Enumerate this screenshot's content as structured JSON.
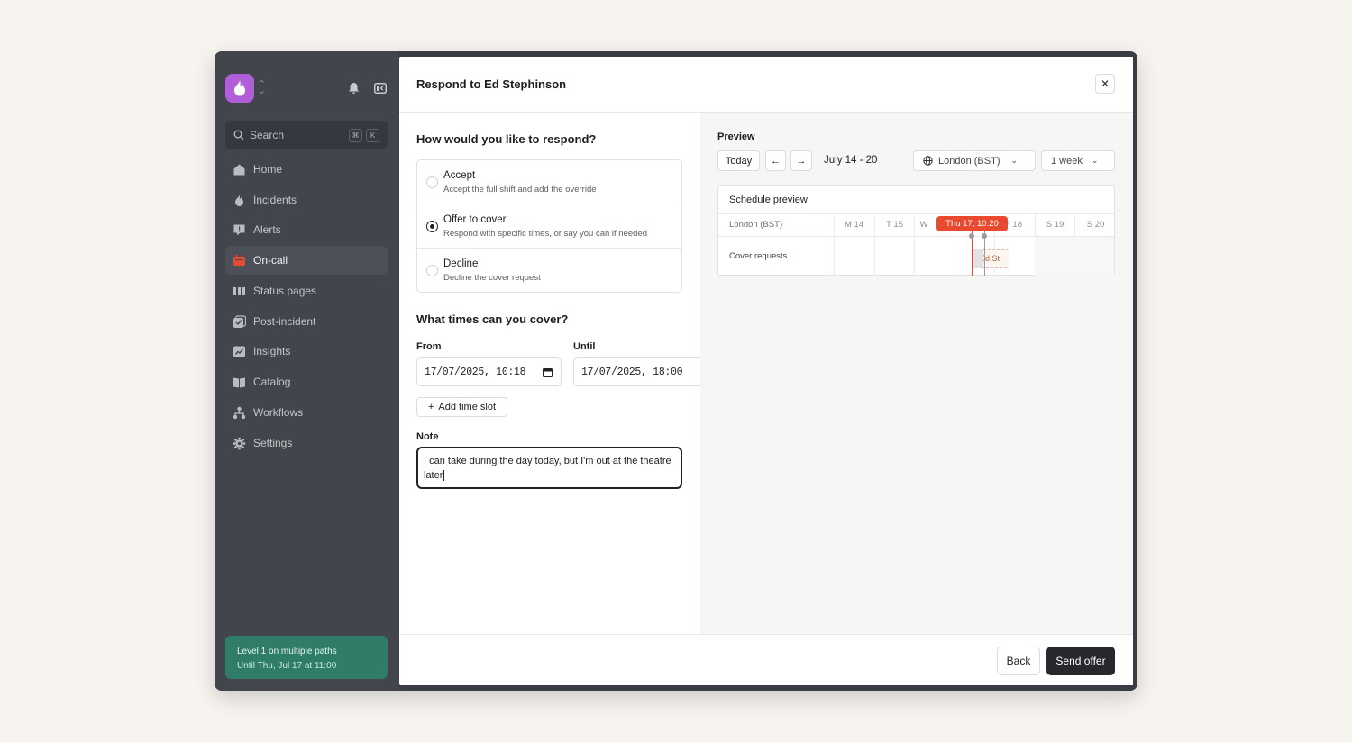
{
  "sidebar": {
    "search_placeholder": "Search",
    "shortcut_keys": [
      "⌘",
      "K"
    ],
    "items": [
      {
        "label": "Home",
        "icon": "home-icon"
      },
      {
        "label": "Incidents",
        "icon": "flame-icon"
      },
      {
        "label": "Alerts",
        "icon": "alert-icon"
      },
      {
        "label": "On-call",
        "icon": "on-call-icon",
        "active": true
      },
      {
        "label": "Status pages",
        "icon": "status-pages-icon"
      },
      {
        "label": "Post-incident",
        "icon": "post-incident-icon"
      },
      {
        "label": "Insights",
        "icon": "insights-icon"
      },
      {
        "label": "Catalog",
        "icon": "catalog-icon"
      },
      {
        "label": "Workflows",
        "icon": "workflows-icon"
      },
      {
        "label": "Settings",
        "icon": "gear-icon"
      }
    ],
    "level_banner": {
      "title": "Level 1 on multiple paths",
      "subtitle": "Until Thu, Jul 17 at 11:00"
    }
  },
  "modal": {
    "title": "Respond to Ed Stephinson",
    "respond_heading": "How would you like to respond?",
    "options": [
      {
        "title": "Accept",
        "desc": "Accept the full shift and add the override",
        "selected": false
      },
      {
        "title": "Offer to cover",
        "desc": "Respond with specific times, or say you can if needed",
        "selected": true
      },
      {
        "title": "Decline",
        "desc": "Decline the cover request",
        "selected": false
      }
    ],
    "times_heading": "What times can you cover?",
    "from_label": "From",
    "from_value": "17/07/2025, 10:18",
    "until_label": "Until",
    "until_value": "17/07/2025, 18:00",
    "add_slot": "Add time slot",
    "note_label": "Note",
    "note_value": "I can take during the day today, but I'm out at the theatre later",
    "preview": {
      "title": "Preview",
      "today": "Today",
      "range": "July 14 - 20",
      "timezone": "London (BST)",
      "span": "1 week",
      "schedule_title": "Schedule preview",
      "tz_label": "London (BST)",
      "days": [
        "M 14",
        "T 15",
        "W",
        "F 18",
        "S 19",
        "S 20"
      ],
      "now_tag": "Thu 17, 10:20",
      "row_label": "Cover requests",
      "block_label": "Ed St",
      "accent": "#e8492f"
    },
    "back": "Back",
    "send": "Send offer"
  }
}
